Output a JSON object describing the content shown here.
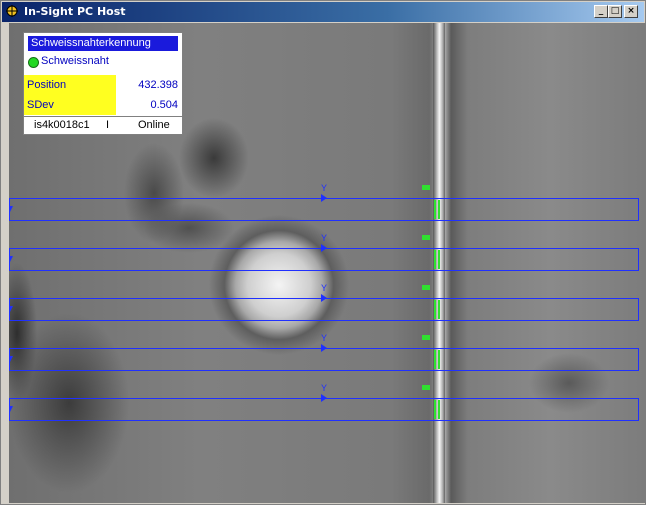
{
  "window": {
    "title": "In-Sight PC Host",
    "icon": "crosshair-icon",
    "controls": {
      "minimize": "_",
      "maximize": "□",
      "close": "×"
    }
  },
  "panel": {
    "title": "Schweissnahterkennung",
    "status_label": "Schweissnaht",
    "status_color": "#22d822",
    "rows": [
      {
        "label": "Position",
        "value": "432.398"
      },
      {
        "label": "SDev",
        "value": "0.504"
      }
    ],
    "footer": {
      "host": "is4k0018c1",
      "separator": "I",
      "state": "Online"
    }
  },
  "overlay": {
    "roi_label": "Y",
    "roi_count": 5,
    "roi_color": "#2030ff",
    "edge_color": "#30e030"
  }
}
